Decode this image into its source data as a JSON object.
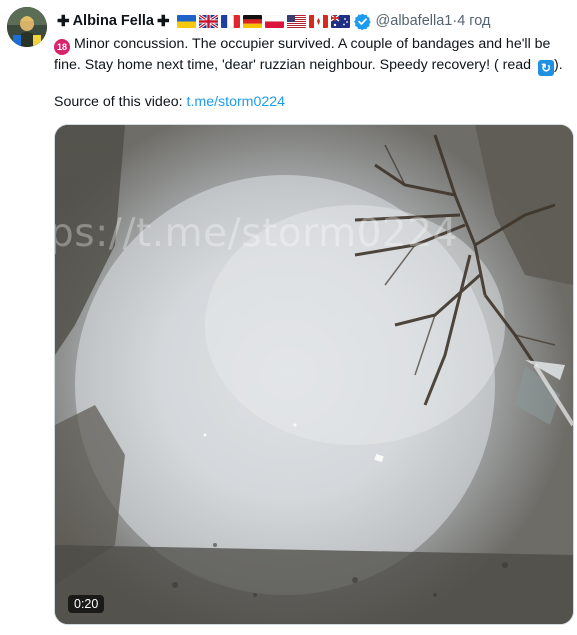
{
  "tweet": {
    "author_name": "Albina Fella",
    "cross_symbol": "✚",
    "handle": "@albafella1",
    "separator": " · ",
    "time": "4 год",
    "verified": true,
    "flags": [
      "ukraine-flag",
      "uk-flag",
      "france-flag",
      "germany-flag",
      "poland-flag",
      "usa-flag",
      "canada-flag",
      "australia-flag"
    ],
    "emoji_18": "18",
    "text": "Minor concussion. The occupier survived. A couple of bandages and he'll be fine. Stay home next time, 'dear' ruzzian neighbour. Speedy recovery! ( read",
    "text_tail": ").",
    "source_label": "Source of this video: ",
    "source_link": "t.me/storm0224"
  },
  "video": {
    "watermark": "ps://t.me/storm0224",
    "duration": "0:20"
  },
  "colors": {
    "link": "#1d9bf0",
    "verified": "#1d9bf0",
    "secondary_text": "#536471"
  }
}
